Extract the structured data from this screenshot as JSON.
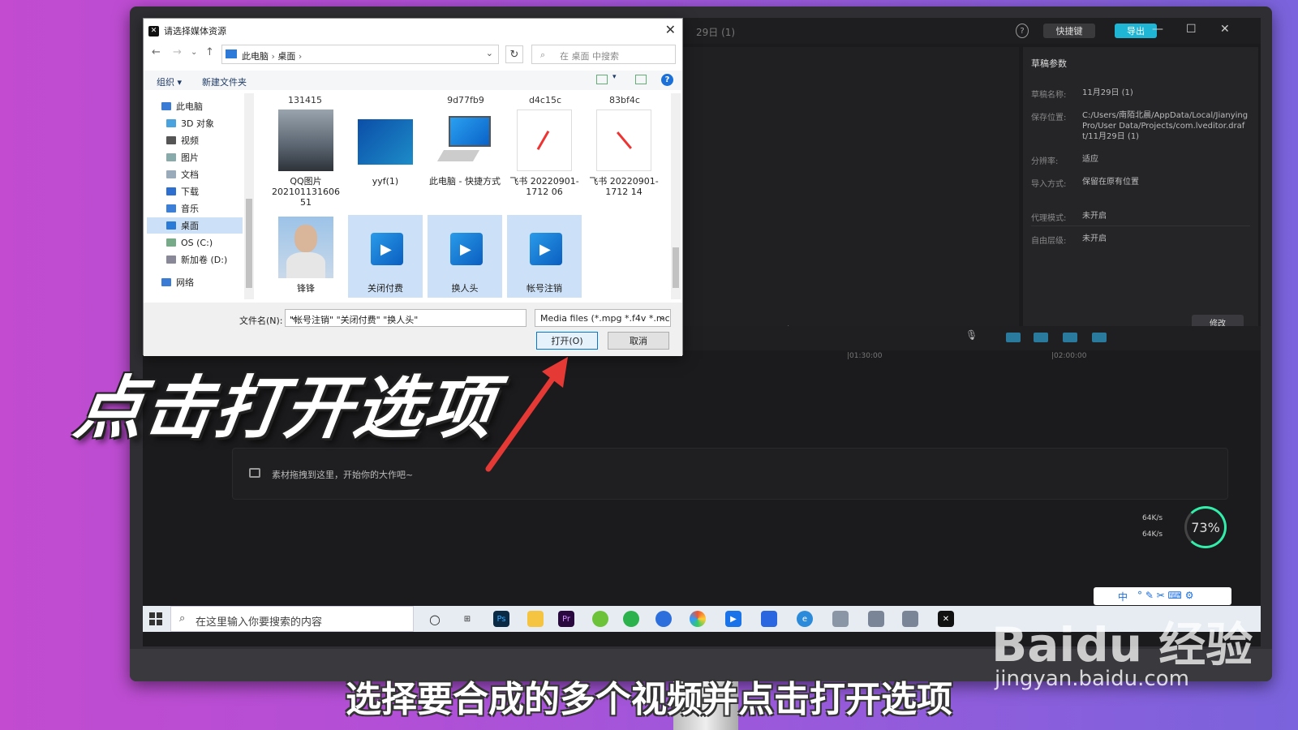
{
  "editor": {
    "project_title": "29日 (1)",
    "shortcut_label": "快捷键",
    "export_label": "导出",
    "draft_panel": {
      "title": "草稿参数",
      "rows": [
        {
          "key": "草稿名称:",
          "value": "11月29日 (1)"
        },
        {
          "key": "保存位置:",
          "value": "C:/Users/南陌北晨/AppData/Local/JianyingPro/User Data/Projects/com.lveditor.draft/11月29日 (1)"
        },
        {
          "key": "分辨率:",
          "value": "适应"
        },
        {
          "key": "导入方式:",
          "value": "保留在原有位置"
        },
        {
          "key": "代理模式:",
          "value": "未开启"
        },
        {
          "key": "自由层级:",
          "value": "未开启"
        }
      ],
      "modify_label": "修改"
    },
    "timeline": {
      "time_a": "|01:30:00",
      "time_b": "|02:00:00",
      "empty_track_text": "素材拖拽到这里，开始你的大作吧~"
    },
    "net": {
      "up": "64K/s",
      "down": "64K/s",
      "percent": "73%"
    }
  },
  "taskbar": {
    "search_placeholder": "在这里输入你要搜索的内容",
    "apps": [
      "cortana-icon",
      "taskview-icon",
      "photoshop-icon",
      "files-icon",
      "premiere-icon",
      "app-icon",
      "wechat-icon",
      "browser-icon",
      "pinwheel-icon",
      "media-icon",
      "feishu-icon",
      "edge-icon",
      "app2-icon",
      "app3-icon",
      "app4-icon",
      "capcut-icon"
    ],
    "ime": "中"
  },
  "dialog": {
    "title": "请选择媒体资源",
    "breadcrumb": [
      "此电脑",
      "桌面"
    ],
    "search_placeholder": "在 桌面 中搜索",
    "organize_label": "组织 ▾",
    "new_folder_label": "新建文件夹",
    "tree": [
      {
        "label": "此电脑",
        "icon": "computer-icon"
      },
      {
        "label": "3D 对象",
        "icon": "3d-icon"
      },
      {
        "label": "视频",
        "icon": "video-folder-icon"
      },
      {
        "label": "图片",
        "icon": "picture-folder-icon"
      },
      {
        "label": "文档",
        "icon": "document-folder-icon"
      },
      {
        "label": "下载",
        "icon": "download-icon"
      },
      {
        "label": "音乐",
        "icon": "music-icon"
      },
      {
        "label": "桌面",
        "icon": "desktop-icon"
      },
      {
        "label": "OS (C:)",
        "icon": "drive-icon"
      },
      {
        "label": "新加卷 (D:)",
        "icon": "drive-icon"
      },
      {
        "label": "网络",
        "icon": "network-icon"
      }
    ],
    "top_labels": [
      "131415",
      "9d77fb9",
      "d4c15c",
      "83bf4c"
    ],
    "files": [
      {
        "name": "QQ图片202101131606 51",
        "kind": "photo"
      },
      {
        "name": "yyf(1)",
        "kind": "image"
      },
      {
        "name": "此电脑 - 快捷方式",
        "kind": "shortcut"
      },
      {
        "name": "飞书 20220901-1712 06",
        "kind": "doc"
      },
      {
        "name": "飞书 20220901-1712 14",
        "kind": "doc"
      },
      {
        "name": "锋锋",
        "kind": "portrait"
      },
      {
        "name": "关闭付费",
        "kind": "video"
      },
      {
        "name": "换人头",
        "kind": "video"
      },
      {
        "name": "帐号注销",
        "kind": "video"
      }
    ],
    "filename_label": "文件名(N):",
    "filename_value": "\"帐号注销\" \"关闭付费\" \"换人头\"",
    "filter_value": "Media files (*.mpg *.f4v *.mc",
    "open_label": "打开(O)",
    "cancel_label": "取消"
  },
  "overlay": {
    "big_caption": "点击打开选项",
    "subtitle": "选择要合成的多个视频并点击打开选项",
    "watermark": "Baidu 经验",
    "watermark_url": "jingyan.baidu.com"
  }
}
